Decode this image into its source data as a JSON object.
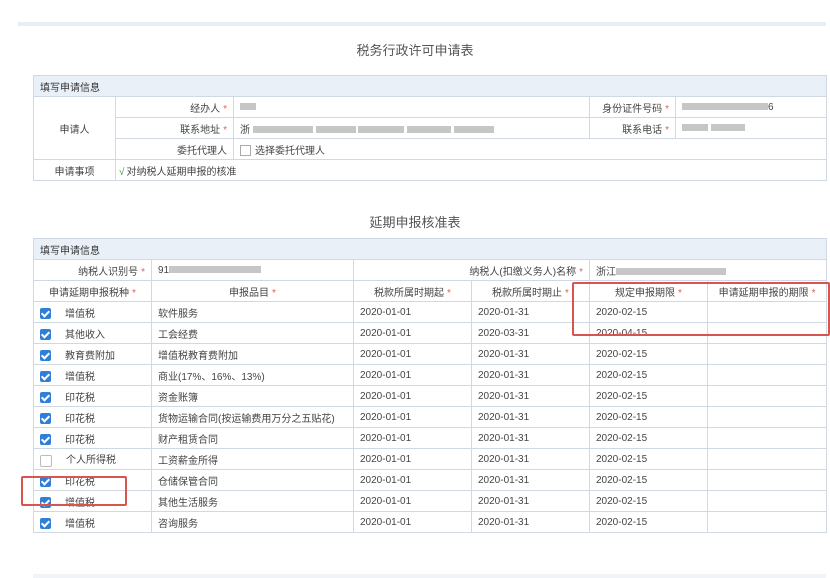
{
  "form_title": "税务行政许可申请表",
  "applicant": {
    "section_label": "填写申请信息",
    "group_label": "申请人",
    "agent_label": "经办人",
    "id_label": "身份证件号码",
    "id_value_tail": "6",
    "address_label": "联系地址",
    "address_prefix": "浙",
    "phone_label": "联系电话",
    "delegate_label": "委托代理人",
    "delegate_option": "选择委托代理人",
    "matter_label": "申请事项",
    "matter_tick": "√",
    "matter_value": "对纳税人延期申报的核准"
  },
  "review_title": "延期申报核准表",
  "review": {
    "section_label": "填写申请信息",
    "taxpayer_id_label": "纳税人识别号",
    "taxpayer_id_prefix": "91",
    "taxpayer_name_label": "纳税人(扣缴义务人)名称",
    "taxpayer_name_prefix": "浙江",
    "columns": [
      "申请延期申报税种",
      "申报品目",
      "税款所属时期起",
      "税款所属时期止",
      "规定申报期限",
      "申请延期申报的期限"
    ],
    "rows": [
      {
        "checked": true,
        "tax": "增值税",
        "item": "软件服务",
        "start": "2020-01-01",
        "end": "2020-01-31",
        "deadline": "2020-02-15",
        "extended": ""
      },
      {
        "checked": true,
        "tax": "其他收入",
        "item": "工会经费",
        "start": "2020-01-01",
        "end": "2020-03-31",
        "deadline": "2020-04-15",
        "extended": ""
      },
      {
        "checked": true,
        "tax": "教育费附加",
        "item": "增值税教育费附加",
        "start": "2020-01-01",
        "end": "2020-01-31",
        "deadline": "2020-02-15",
        "extended": ""
      },
      {
        "checked": true,
        "tax": "增值税",
        "item": "商业(17%、16%、13%)",
        "start": "2020-01-01",
        "end": "2020-01-31",
        "deadline": "2020-02-15",
        "extended": ""
      },
      {
        "checked": true,
        "tax": "印花税",
        "item": "资金账簿",
        "start": "2020-01-01",
        "end": "2020-01-31",
        "deadline": "2020-02-15",
        "extended": ""
      },
      {
        "checked": true,
        "tax": "印花税",
        "item": "货物运输合同(按运输费用万分之五贴花)",
        "start": "2020-01-01",
        "end": "2020-01-31",
        "deadline": "2020-02-15",
        "extended": ""
      },
      {
        "checked": true,
        "tax": "印花税",
        "item": "财产租赁合同",
        "start": "2020-01-01",
        "end": "2020-01-31",
        "deadline": "2020-02-15",
        "extended": ""
      },
      {
        "checked": false,
        "tax": "个人所得税",
        "item": "工资薪金所得",
        "start": "2020-01-01",
        "end": "2020-01-31",
        "deadline": "2020-02-15",
        "extended": ""
      },
      {
        "checked": true,
        "tax": "印花税",
        "item": "仓储保管合同",
        "start": "2020-01-01",
        "end": "2020-01-31",
        "deadline": "2020-02-15",
        "extended": ""
      },
      {
        "checked": true,
        "tax": "增值税",
        "item": "其他生活服务",
        "start": "2020-01-01",
        "end": "2020-01-31",
        "deadline": "2020-02-15",
        "extended": ""
      },
      {
        "checked": true,
        "tax": "增值税",
        "item": "咨询服务",
        "start": "2020-01-01",
        "end": "2020-01-31",
        "deadline": "2020-02-15",
        "extended": ""
      }
    ]
  },
  "colors": {
    "checkbox": "#2f7ed8",
    "highlight": "#d9534f",
    "required": "#e45c5c",
    "section_bg": "#e9f0f8"
  }
}
